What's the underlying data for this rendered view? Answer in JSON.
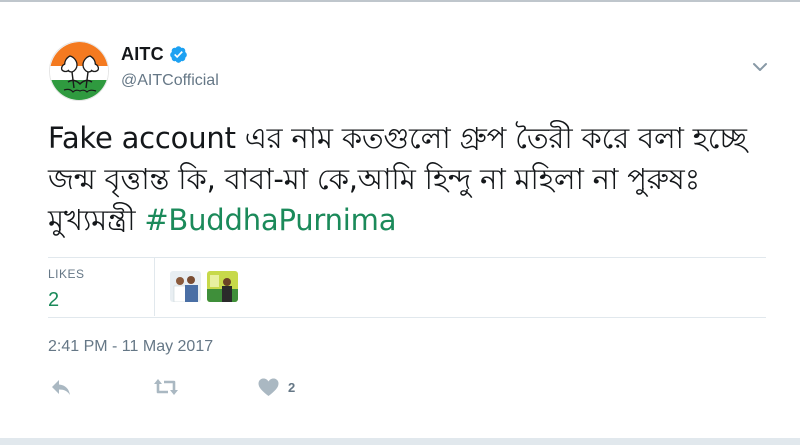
{
  "header": {
    "display_name": "AITC",
    "handle": "@AITCofficial",
    "verified": true
  },
  "tweet": {
    "text_before_hashtag": "Fake account এর নাম কতগুলো গ্রুপ তৈরী করে বলা হচ্ছে জন্ম বৃত্তান্ত কি, বাবা-মা কে,আমি হিন্দু না মহিলা না পুরুষঃ মুখ্যমন্ত্রী ",
    "hashtag": "#BuddhaPurnima",
    "hashtag_color": "#1b8a5a"
  },
  "stats": {
    "likes_label": "LIKES",
    "likes_count": "2"
  },
  "timestamp": "2:41 PM - 11 May 2017",
  "actions": {
    "like_count": "2"
  },
  "icons": [
    "tmc-logo-avatar",
    "verified-badge-icon",
    "chevron-down-icon",
    "reply-icon",
    "retweet-icon",
    "heart-icon"
  ],
  "colors": {
    "verified": "#1da1f2",
    "muted": "#657786",
    "divider": "#e1e8ed",
    "action_icon": "#aab8c2"
  }
}
